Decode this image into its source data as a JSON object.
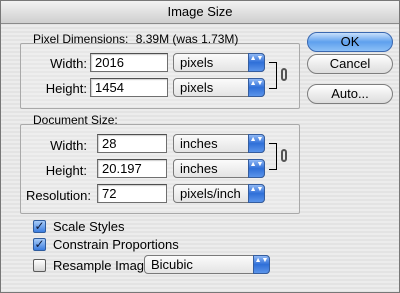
{
  "window": {
    "title": "Image Size"
  },
  "pixel_dimensions": {
    "title": "Pixel Dimensions:",
    "summary": "8.39M (was 1.73M)",
    "width_label": "Width:",
    "width_value": "2016",
    "width_unit": "pixels",
    "height_label": "Height:",
    "height_value": "1454",
    "height_unit": "pixels"
  },
  "document_size": {
    "title": "Document Size:",
    "width_label": "Width:",
    "width_value": "28",
    "width_unit": "inches",
    "height_label": "Height:",
    "height_value": "20.197",
    "height_unit": "inches",
    "resolution_label": "Resolution:",
    "resolution_value": "72",
    "resolution_unit": "pixels/inch"
  },
  "options": {
    "scale_styles": {
      "label": "Scale Styles",
      "checked": true,
      "mark": "✓"
    },
    "constrain_proportions": {
      "label": "Constrain Proportions",
      "checked": true,
      "mark": "✓"
    },
    "resample_image": {
      "label": "Resample Image:",
      "checked": false,
      "method": "Bicubic"
    }
  },
  "buttons": {
    "ok": "OK",
    "cancel": "Cancel",
    "auto": "Auto..."
  },
  "icons": {
    "popup_arrows": "▲▼"
  },
  "colors": {
    "accent": "#3b7de0",
    "default_button": "#5ea0ee"
  }
}
